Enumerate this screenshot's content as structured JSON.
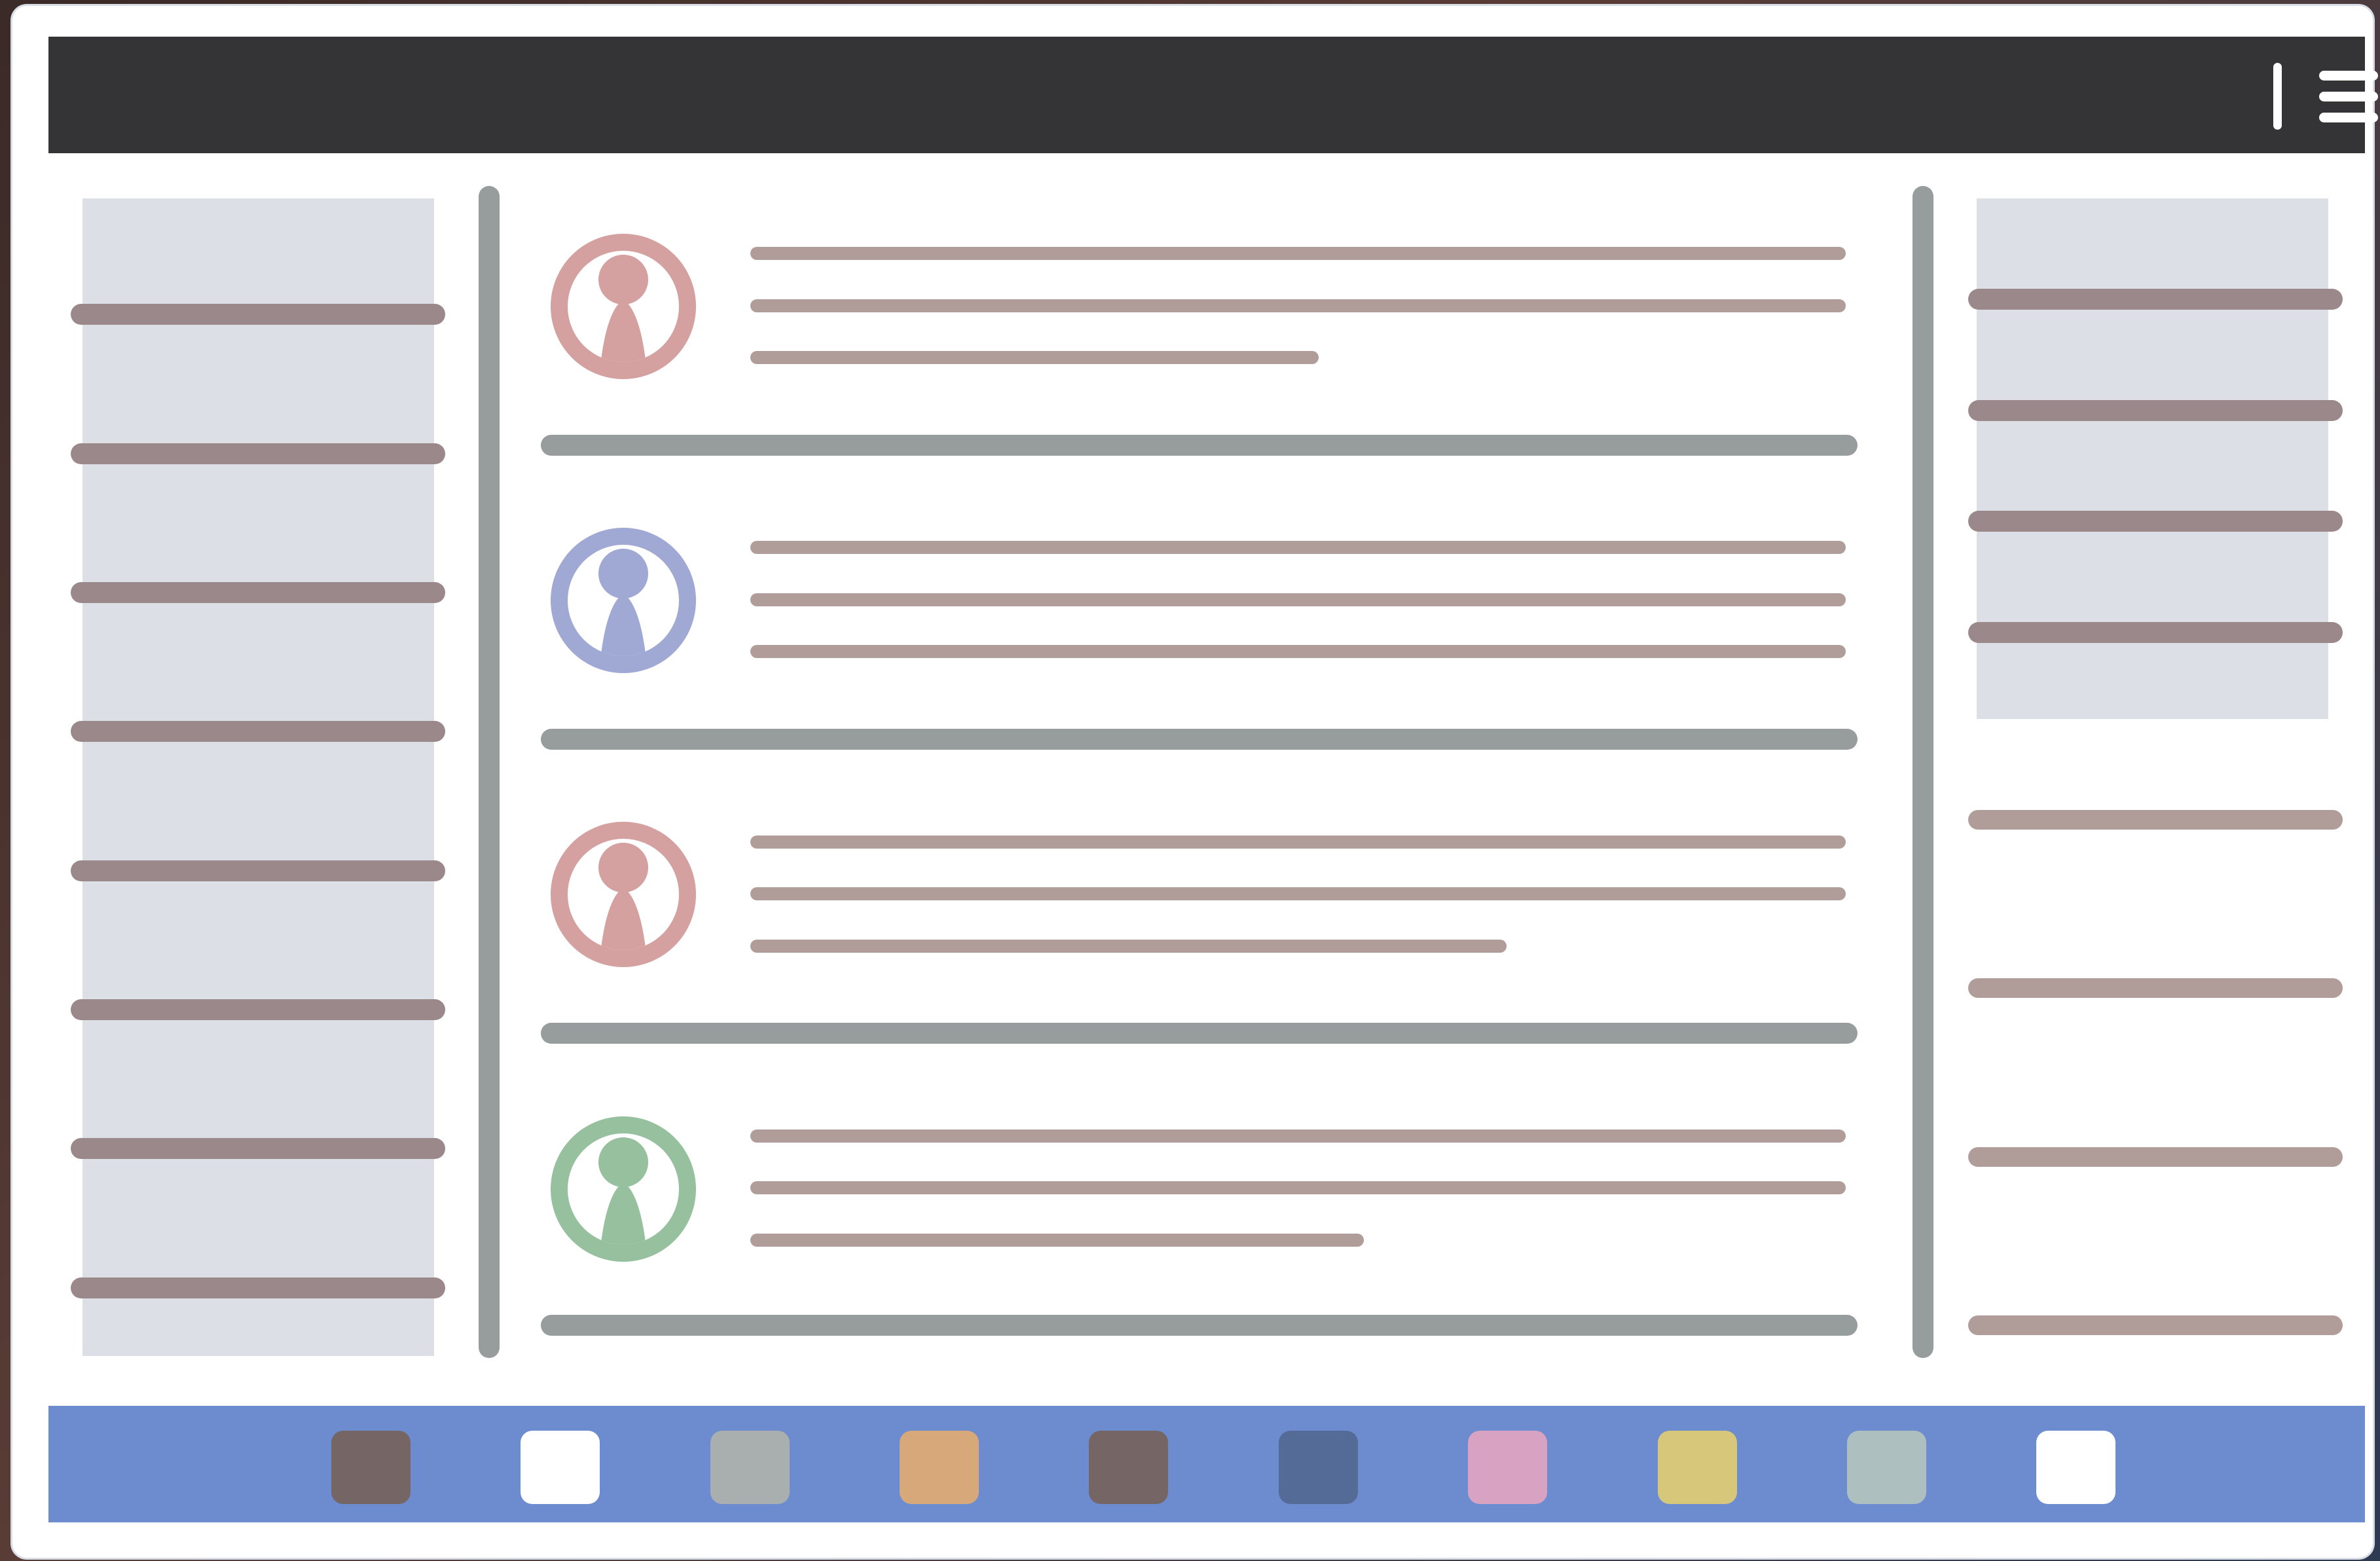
{
  "colors": {
    "topbar": "#343436",
    "panel": "#dcdfe5",
    "nav_line": "#9b888a",
    "text_line": "#b09c98",
    "divider": "#979c9c",
    "dock": "#6d8ccf"
  },
  "topbar": {
    "menu_icon": "hamburger-menu-icon"
  },
  "feed": {
    "posts": [
      {
        "avatar_icon": "user-avatar-icon",
        "avatar_color": "#d4a0a0"
      },
      {
        "avatar_icon": "user-avatar-icon",
        "avatar_color": "#a0a8d4"
      },
      {
        "avatar_icon": "user-avatar-icon",
        "avatar_color": "#d4a0a0"
      },
      {
        "avatar_icon": "user-avatar-icon",
        "avatar_color": "#96c09e"
      }
    ]
  },
  "dock": {
    "apps": [
      {
        "icon": "app-icon",
        "color": "#756565"
      },
      {
        "icon": "app-icon",
        "color": "#ffffff"
      },
      {
        "icon": "app-icon",
        "color": "#a9afaf"
      },
      {
        "icon": "app-icon",
        "color": "#d7a879"
      },
      {
        "icon": "app-icon",
        "color": "#756565"
      },
      {
        "icon": "app-icon",
        "color": "#536b96"
      },
      {
        "icon": "app-icon",
        "color": "#d8a3c3"
      },
      {
        "icon": "app-icon",
        "color": "#d6c77b"
      },
      {
        "icon": "app-icon",
        "color": "#adbfbf"
      },
      {
        "icon": "app-icon",
        "color": "#ffffff"
      }
    ]
  }
}
